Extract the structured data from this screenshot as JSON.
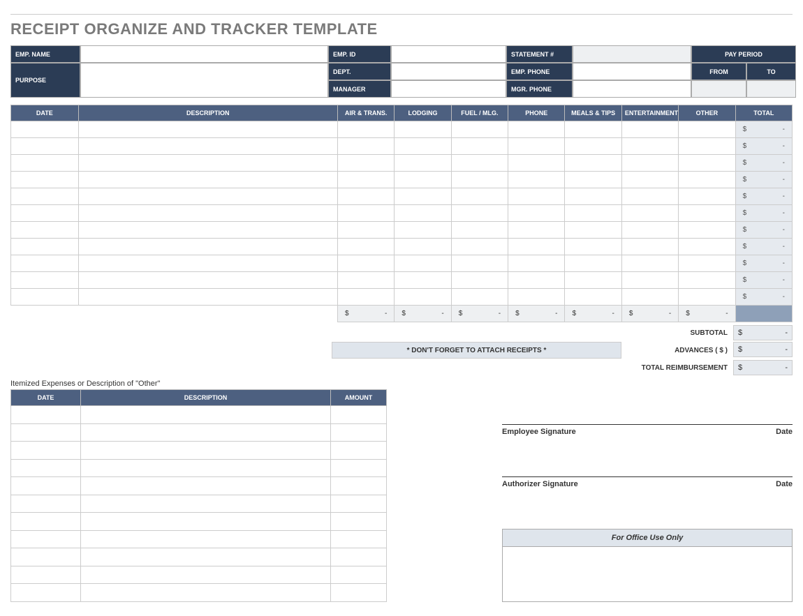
{
  "title": "RECEIPT ORGANIZE AND TRACKER TEMPLATE",
  "info": {
    "emp_name": "EMP. NAME",
    "emp_id": "EMP. ID",
    "statement_num": "STATEMENT #",
    "pay_period": "PAY PERIOD",
    "dept": "DEPT.",
    "emp_phone": "EMP. PHONE",
    "purpose": "PURPOSE",
    "from": "FROM",
    "to": "TO",
    "manager": "MANAGER",
    "mgr_phone": "MGR. PHONE"
  },
  "columns": {
    "date": "DATE",
    "description": "DESCRIPTION",
    "air_trans": "AIR & TRANS.",
    "lodging": "LODGING",
    "fuel_mlg": "FUEL / MLG.",
    "phone": "PHONE",
    "meals_tips": "MEALS & TIPS",
    "entertainment": "ENTERTAINMENT",
    "other": "OTHER",
    "total": "TOTAL"
  },
  "row_count": 11,
  "empty_money": {
    "symbol": "$",
    "value": "-"
  },
  "summary": {
    "subtotal": "SUBTOTAL",
    "advances": "ADVANCES  ( $ )",
    "total_reimbursement": "TOTAL REIMBURSEMENT"
  },
  "reminder": "* DON'T FORGET TO ATTACH RECEIPTS *",
  "itemized": {
    "heading": "Itemized Expenses or Description of \"Other\"",
    "cols": {
      "date": "DATE",
      "description": "DESCRIPTION",
      "amount": "AMOUNT"
    },
    "row_count": 11
  },
  "signatures": {
    "employee": "Employee Signature",
    "authorizer": "Authorizer Signature",
    "date": "Date"
  },
  "office": "For Office Use Only"
}
